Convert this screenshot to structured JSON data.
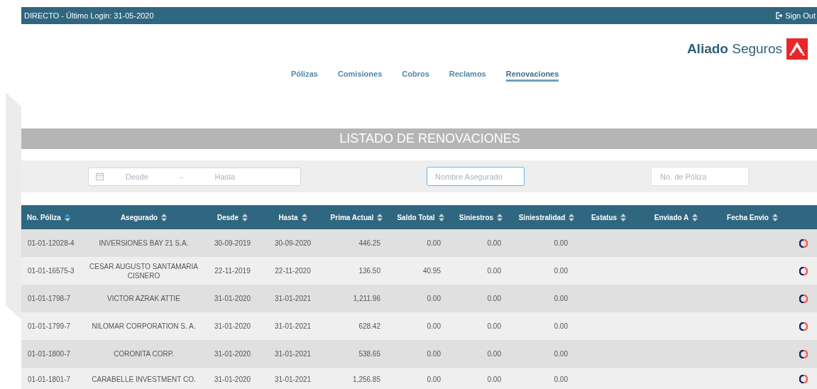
{
  "top_bar": {
    "session": "DIRECTO - Último Login: 31-05-2020",
    "sign_out": "Sign Out"
  },
  "brand": {
    "name": "**Aliado** Seguros"
  },
  "nav": [
    {
      "label": "Pólizas",
      "selected": false
    },
    {
      "label": "Comisiones",
      "selected": false
    },
    {
      "label": "Cobros",
      "selected": false
    },
    {
      "label": "Reclamos",
      "selected": false
    },
    {
      "label": "Renovaciones",
      "selected": true
    }
  ],
  "title": "LISTADO DE RENOVACIONES",
  "filters": {
    "date_range": {
      "from_placeholder": "Desde",
      "separator": "-",
      "to_placeholder": "Hasta"
    },
    "fields": [
      {
        "placeholder": "Nombre Asegurado",
        "focused": true
      },
      {
        "placeholder": "No. de Póliza",
        "focused": false
      }
    ]
  },
  "table": {
    "columns": [
      {
        "label": "No. Póliza",
        "sorted": true
      },
      {
        "label": "Asegurado",
        "sorted": false
      },
      {
        "label": "Desde",
        "sorted": false
      },
      {
        "label": "Hasta",
        "sorted": false
      },
      {
        "label": "Prima Actual",
        "sorted": false
      },
      {
        "label": "Saldo Total",
        "sorted": false
      },
      {
        "label": "Siniestros",
        "sorted": false
      },
      {
        "label": "Siniestralidad",
        "sorted": false
      },
      {
        "label": "Estatus",
        "sorted": false
      },
      {
        "label": "Enviado A",
        "sorted": false
      },
      {
        "label": "Fecha Envio",
        "sorted": false
      }
    ],
    "rows": [
      {
        "poliza": "01-01-12028-4",
        "asegurado": "INVERSIONES BAY 21 S.A.",
        "desde": "30-09-2019",
        "hasta": "30-09-2020",
        "prima": "446.25",
        "saldo": "0.00",
        "siniestros": "0.00",
        "siniestralidad": "0.00"
      },
      {
        "poliza": "01-01-16575-3",
        "asegurado": "CESAR AUGUSTO SANTAMARIA CISNERO",
        "desde": "22-11-2019",
        "hasta": "22-11-2020",
        "prima": "136.50",
        "saldo": "40.95",
        "siniestros": "0.00",
        "siniestralidad": "0.00"
      },
      {
        "poliza": "01-01-1798-7",
        "asegurado": "VICTOR AZRAK ATTIE",
        "desde": "31-01-2020",
        "hasta": "31-01-2021",
        "prima": "1,211.96",
        "saldo": "0.00",
        "siniestros": "0.00",
        "siniestralidad": "0.00"
      },
      {
        "poliza": "01-01-1799-7",
        "asegurado": "NILOMAR CORPORATION S. A.",
        "desde": "31-01-2020",
        "hasta": "31-01-2021",
        "prima": "628.42",
        "saldo": "0.00",
        "siniestros": "0.00",
        "siniestralidad": "0.00"
      },
      {
        "poliza": "01-01-1800-7",
        "asegurado": "CORONITA CORP.",
        "desde": "31-01-2020",
        "hasta": "31-01-2021",
        "prima": "538.65",
        "saldo": "0.00",
        "siniestros": "0.00",
        "siniestralidad": "0.00"
      },
      {
        "poliza": "01-01-1801-7",
        "asegurado": "CARABELLE INVESTMENT CO.",
        "desde": "31-01-2020",
        "hasta": "31-01-2021",
        "prima": "1,256.85",
        "saldo": "0.00",
        "siniestros": "0.00",
        "siniestralidad": "0.00"
      }
    ]
  }
}
